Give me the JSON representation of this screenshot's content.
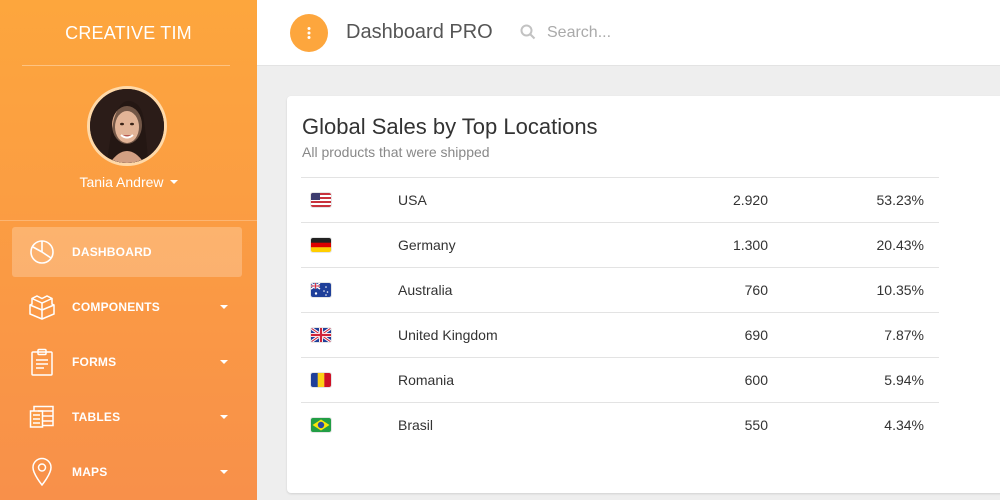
{
  "sidebar": {
    "brand": "CREATIVE TIM",
    "user_name": "Tania Andrew",
    "items": [
      {
        "label": "DASHBOARD",
        "icon": "pie-chart-icon",
        "active": true
      },
      {
        "label": "COMPONENTS",
        "icon": "cubes-icon",
        "caret": true
      },
      {
        "label": "FORMS",
        "icon": "clipboard-icon",
        "caret": true
      },
      {
        "label": "TABLES",
        "icon": "table-icon",
        "caret": true
      },
      {
        "label": "MAPS",
        "icon": "map-pin-icon",
        "caret": true
      }
    ]
  },
  "header": {
    "title": "Dashboard PRO",
    "search_placeholder": "Search..."
  },
  "card": {
    "title": "Global Sales by Top Locations",
    "subtitle": "All products that were shipped",
    "rows": [
      {
        "flag": "us-flag-icon",
        "country": "USA",
        "sales": "2.920",
        "percent": "53.23%"
      },
      {
        "flag": "de-flag-icon",
        "country": "Germany",
        "sales": "1.300",
        "percent": "20.43%"
      },
      {
        "flag": "au-flag-icon",
        "country": "Australia",
        "sales": "760",
        "percent": "10.35%"
      },
      {
        "flag": "gb-flag-icon",
        "country": "United Kingdom",
        "sales": "690",
        "percent": "7.87%"
      },
      {
        "flag": "ro-flag-icon",
        "country": "Romania",
        "sales": "600",
        "percent": "5.94%"
      },
      {
        "flag": "br-flag-icon",
        "country": "Brasil",
        "sales": "550",
        "percent": "4.34%"
      }
    ]
  },
  "colors": {
    "accent": "#fda63d",
    "sidebar_bottom": "#f8904a"
  }
}
